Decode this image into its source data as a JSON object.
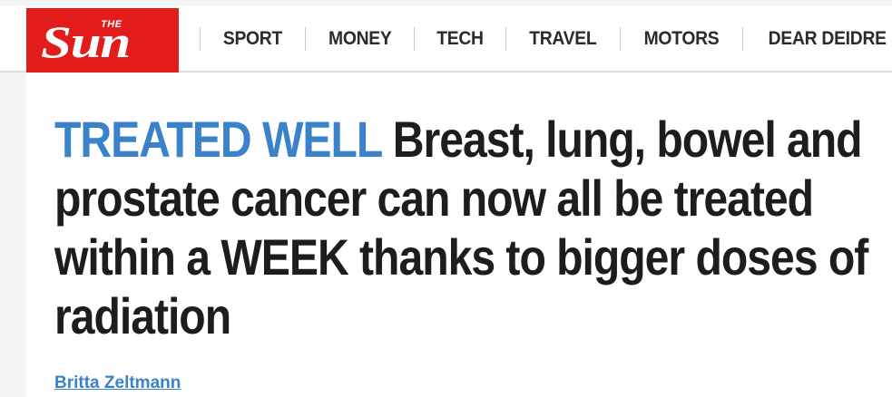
{
  "header": {
    "logo": {
      "small_text": "THE",
      "main_text": "Sun"
    },
    "nav": [
      {
        "label": "SPORT"
      },
      {
        "label": "MONEY"
      },
      {
        "label": "TECH"
      },
      {
        "label": "TRAVEL"
      },
      {
        "label": "MOTORS"
      },
      {
        "label": "DEAR DEIDRE"
      }
    ]
  },
  "article": {
    "kicker": "TREATED WELL",
    "headline": "Breast, lung, bowel and prostate cancer can now all be treated within a WEEK thanks to bigger doses of radiation",
    "byline": "Britta Zeltmann"
  },
  "colors": {
    "brand_red": "#e21b1b",
    "kicker_blue": "#3a82c9",
    "headline_text": "#1d1d1d"
  }
}
